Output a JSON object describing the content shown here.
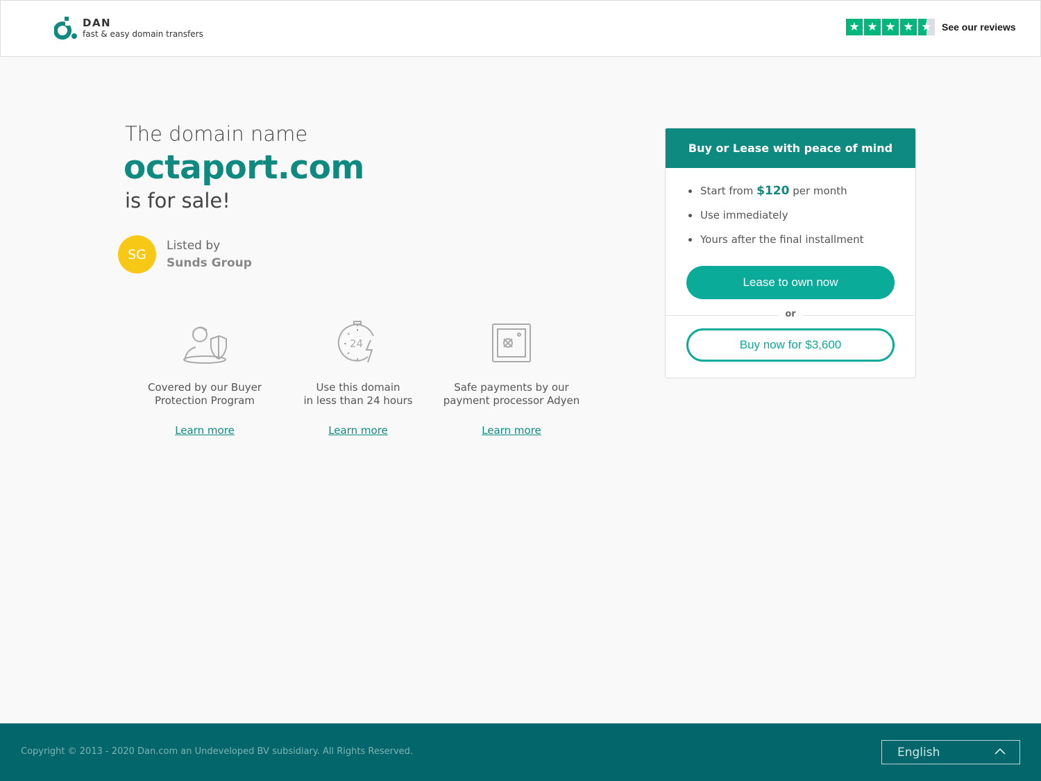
{
  "header": {
    "logo_name": "DAN",
    "logo_tagline": "fast & easy domain transfers",
    "reviews_label": "See our reviews",
    "trustpilot_stars": 4.5,
    "trustpilot_color": "#00b67a"
  },
  "hero": {
    "line1": "The domain name",
    "domain": "octaport.com",
    "line3": "is for sale!"
  },
  "seller": {
    "initials": "SG",
    "listed_by": "Listed by",
    "name": "Sunds Group",
    "avatar_color": "#f7c815"
  },
  "features": [
    {
      "icon": "buyer-protection-icon",
      "line1": "Covered by our Buyer",
      "line2": "Protection Program",
      "link": "Learn more"
    },
    {
      "icon": "24-hours-stopwatch-icon",
      "line1": "Use this domain",
      "line2": "in less than 24 hours",
      "link": "Learn more"
    },
    {
      "icon": "safe-icon",
      "line1": "Safe payments by our",
      "line2": "payment processor Adyen",
      "link": "Learn more"
    }
  ],
  "card": {
    "title": "Buy or Lease with peace of mind",
    "bullet1_prefix": "Start from",
    "bullet1_price": "$120",
    "bullet1_suffix": "per month",
    "bullet2": "Use immediately",
    "bullet3": "Yours after the final installment",
    "lease_button": "Lease to own now",
    "or_label": "or",
    "buy_button": "Buy now for $3,600",
    "accent": "#0e8a80",
    "button_color": "#0bab9a"
  },
  "footer": {
    "copyright": "Copyright © 2013 - 2020 Dan.com an Undeveloped BV subsidiary. All Rights Reserved.",
    "language": "English",
    "background": "#03666a"
  }
}
